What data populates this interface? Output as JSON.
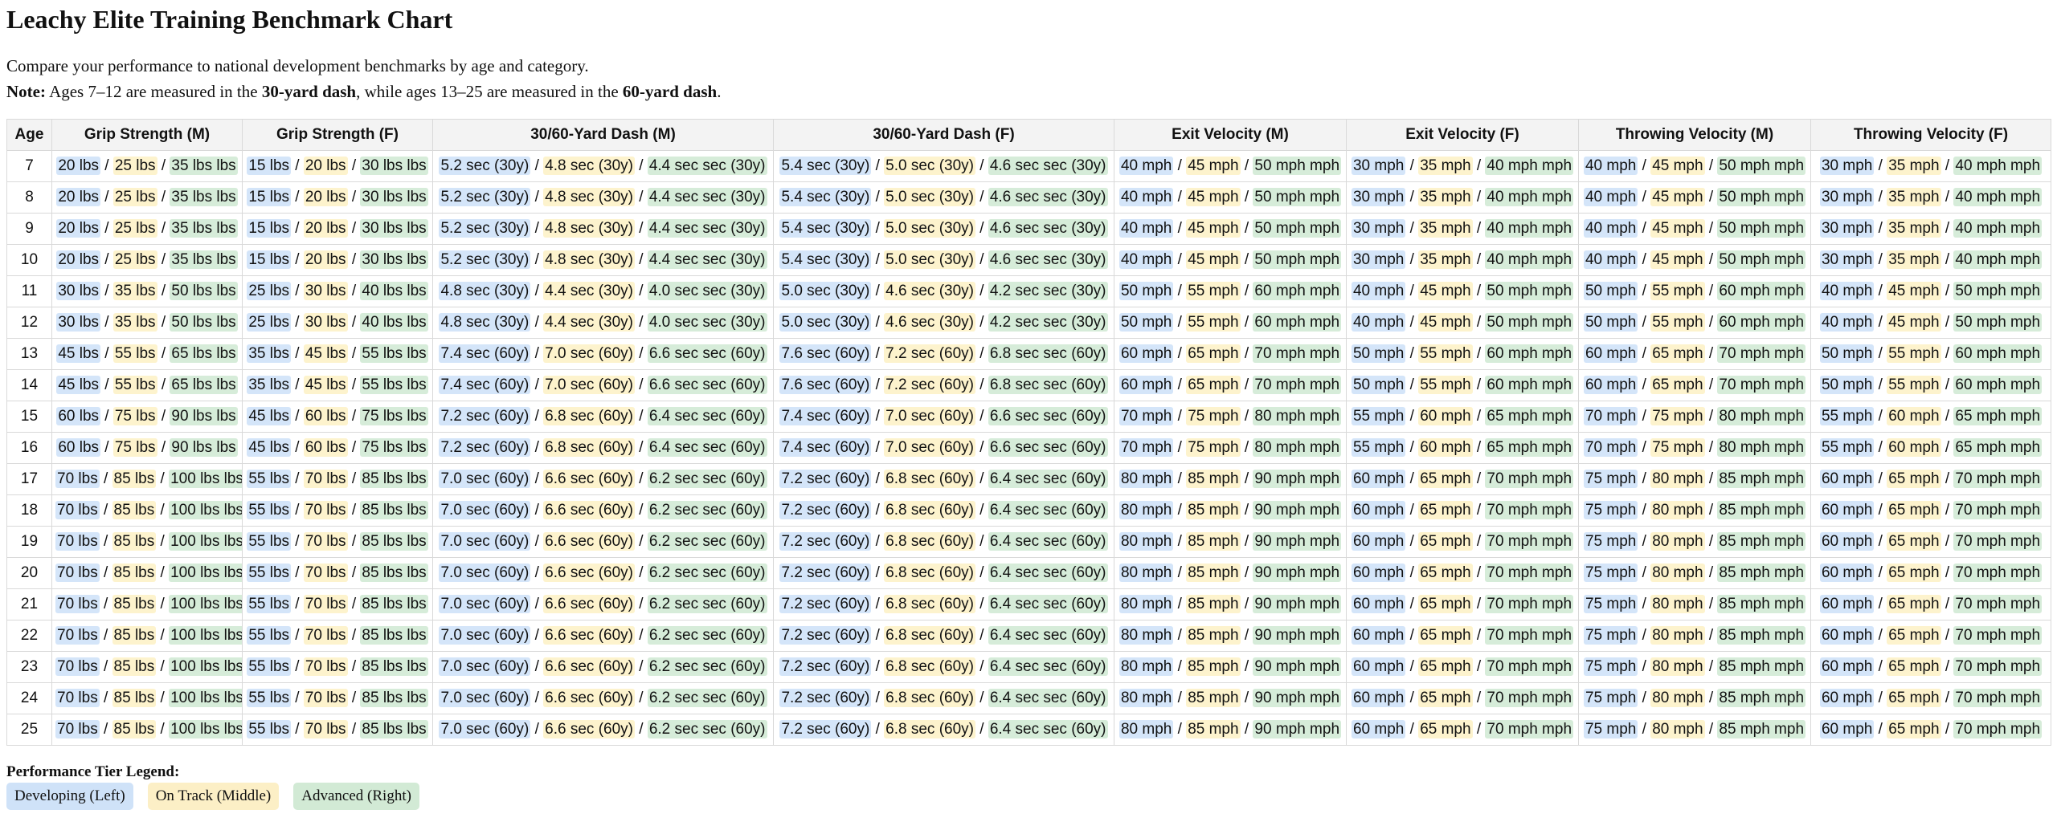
{
  "title": "Leachy Elite Training Benchmark Chart",
  "intro": "Compare your performance to national development benchmarks by age and category.",
  "note": {
    "label": "Note:",
    "text1": " Ages 7–12 are measured in the ",
    "bold1": "30-yard dash",
    "text2": ", while ages 13–25 are measured in the ",
    "bold2": "60-yard dash",
    "text3": "."
  },
  "columns": [
    "Age",
    "Grip Strength (M)",
    "Grip Strength (F)",
    "30/60-Yard Dash (M)",
    "30/60-Yard Dash (F)",
    "Exit Velocity (M)",
    "Exit Velocity (F)",
    "Throwing Velocity (M)",
    "Throwing Velocity (F)"
  ],
  "rows": [
    {
      "age": "7",
      "cells": [
        [
          "20 lbs",
          "25 lbs",
          "35 lbs lbs"
        ],
        [
          "15 lbs",
          "20 lbs",
          "30 lbs lbs"
        ],
        [
          "5.2 sec (30y)",
          "4.8 sec (30y)",
          "4.4 sec sec (30y)"
        ],
        [
          "5.4 sec (30y)",
          "5.0 sec (30y)",
          "4.6 sec sec (30y)"
        ],
        [
          "40 mph",
          "45 mph",
          "50 mph mph"
        ],
        [
          "30 mph",
          "35 mph",
          "40 mph mph"
        ],
        [
          "40 mph",
          "45 mph",
          "50 mph mph"
        ],
        [
          "30 mph",
          "35 mph",
          "40 mph mph"
        ]
      ]
    },
    {
      "age": "8",
      "cells": [
        [
          "20 lbs",
          "25 lbs",
          "35 lbs lbs"
        ],
        [
          "15 lbs",
          "20 lbs",
          "30 lbs lbs"
        ],
        [
          "5.2 sec (30y)",
          "4.8 sec (30y)",
          "4.4 sec sec (30y)"
        ],
        [
          "5.4 sec (30y)",
          "5.0 sec (30y)",
          "4.6 sec sec (30y)"
        ],
        [
          "40 mph",
          "45 mph",
          "50 mph mph"
        ],
        [
          "30 mph",
          "35 mph",
          "40 mph mph"
        ],
        [
          "40 mph",
          "45 mph",
          "50 mph mph"
        ],
        [
          "30 mph",
          "35 mph",
          "40 mph mph"
        ]
      ]
    },
    {
      "age": "9",
      "cells": [
        [
          "20 lbs",
          "25 lbs",
          "35 lbs lbs"
        ],
        [
          "15 lbs",
          "20 lbs",
          "30 lbs lbs"
        ],
        [
          "5.2 sec (30y)",
          "4.8 sec (30y)",
          "4.4 sec sec (30y)"
        ],
        [
          "5.4 sec (30y)",
          "5.0 sec (30y)",
          "4.6 sec sec (30y)"
        ],
        [
          "40 mph",
          "45 mph",
          "50 mph mph"
        ],
        [
          "30 mph",
          "35 mph",
          "40 mph mph"
        ],
        [
          "40 mph",
          "45 mph",
          "50 mph mph"
        ],
        [
          "30 mph",
          "35 mph",
          "40 mph mph"
        ]
      ]
    },
    {
      "age": "10",
      "cells": [
        [
          "20 lbs",
          "25 lbs",
          "35 lbs lbs"
        ],
        [
          "15 lbs",
          "20 lbs",
          "30 lbs lbs"
        ],
        [
          "5.2 sec (30y)",
          "4.8 sec (30y)",
          "4.4 sec sec (30y)"
        ],
        [
          "5.4 sec (30y)",
          "5.0 sec (30y)",
          "4.6 sec sec (30y)"
        ],
        [
          "40 mph",
          "45 mph",
          "50 mph mph"
        ],
        [
          "30 mph",
          "35 mph",
          "40 mph mph"
        ],
        [
          "40 mph",
          "45 mph",
          "50 mph mph"
        ],
        [
          "30 mph",
          "35 mph",
          "40 mph mph"
        ]
      ]
    },
    {
      "age": "11",
      "cells": [
        [
          "30 lbs",
          "35 lbs",
          "50 lbs lbs"
        ],
        [
          "25 lbs",
          "30 lbs",
          "40 lbs lbs"
        ],
        [
          "4.8 sec (30y)",
          "4.4 sec (30y)",
          "4.0 sec sec (30y)"
        ],
        [
          "5.0 sec (30y)",
          "4.6 sec (30y)",
          "4.2 sec sec (30y)"
        ],
        [
          "50 mph",
          "55 mph",
          "60 mph mph"
        ],
        [
          "40 mph",
          "45 mph",
          "50 mph mph"
        ],
        [
          "50 mph",
          "55 mph",
          "60 mph mph"
        ],
        [
          "40 mph",
          "45 mph",
          "50 mph mph"
        ]
      ]
    },
    {
      "age": "12",
      "cells": [
        [
          "30 lbs",
          "35 lbs",
          "50 lbs lbs"
        ],
        [
          "25 lbs",
          "30 lbs",
          "40 lbs lbs"
        ],
        [
          "4.8 sec (30y)",
          "4.4 sec (30y)",
          "4.0 sec sec (30y)"
        ],
        [
          "5.0 sec (30y)",
          "4.6 sec (30y)",
          "4.2 sec sec (30y)"
        ],
        [
          "50 mph",
          "55 mph",
          "60 mph mph"
        ],
        [
          "40 mph",
          "45 mph",
          "50 mph mph"
        ],
        [
          "50 mph",
          "55 mph",
          "60 mph mph"
        ],
        [
          "40 mph",
          "45 mph",
          "50 mph mph"
        ]
      ]
    },
    {
      "age": "13",
      "cells": [
        [
          "45 lbs",
          "55 lbs",
          "65 lbs lbs"
        ],
        [
          "35 lbs",
          "45 lbs",
          "55 lbs lbs"
        ],
        [
          "7.4 sec (60y)",
          "7.0 sec (60y)",
          "6.6 sec sec (60y)"
        ],
        [
          "7.6 sec (60y)",
          "7.2 sec (60y)",
          "6.8 sec sec (60y)"
        ],
        [
          "60 mph",
          "65 mph",
          "70 mph mph"
        ],
        [
          "50 mph",
          "55 mph",
          "60 mph mph"
        ],
        [
          "60 mph",
          "65 mph",
          "70 mph mph"
        ],
        [
          "50 mph",
          "55 mph",
          "60 mph mph"
        ]
      ]
    },
    {
      "age": "14",
      "cells": [
        [
          "45 lbs",
          "55 lbs",
          "65 lbs lbs"
        ],
        [
          "35 lbs",
          "45 lbs",
          "55 lbs lbs"
        ],
        [
          "7.4 sec (60y)",
          "7.0 sec (60y)",
          "6.6 sec sec (60y)"
        ],
        [
          "7.6 sec (60y)",
          "7.2 sec (60y)",
          "6.8 sec sec (60y)"
        ],
        [
          "60 mph",
          "65 mph",
          "70 mph mph"
        ],
        [
          "50 mph",
          "55 mph",
          "60 mph mph"
        ],
        [
          "60 mph",
          "65 mph",
          "70 mph mph"
        ],
        [
          "50 mph",
          "55 mph",
          "60 mph mph"
        ]
      ]
    },
    {
      "age": "15",
      "cells": [
        [
          "60 lbs",
          "75 lbs",
          "90 lbs lbs"
        ],
        [
          "45 lbs",
          "60 lbs",
          "75 lbs lbs"
        ],
        [
          "7.2 sec (60y)",
          "6.8 sec (60y)",
          "6.4 sec sec (60y)"
        ],
        [
          "7.4 sec (60y)",
          "7.0 sec (60y)",
          "6.6 sec sec (60y)"
        ],
        [
          "70 mph",
          "75 mph",
          "80 mph mph"
        ],
        [
          "55 mph",
          "60 mph",
          "65 mph mph"
        ],
        [
          "70 mph",
          "75 mph",
          "80 mph mph"
        ],
        [
          "55 mph",
          "60 mph",
          "65 mph mph"
        ]
      ]
    },
    {
      "age": "16",
      "cells": [
        [
          "60 lbs",
          "75 lbs",
          "90 lbs lbs"
        ],
        [
          "45 lbs",
          "60 lbs",
          "75 lbs lbs"
        ],
        [
          "7.2 sec (60y)",
          "6.8 sec (60y)",
          "6.4 sec sec (60y)"
        ],
        [
          "7.4 sec (60y)",
          "7.0 sec (60y)",
          "6.6 sec sec (60y)"
        ],
        [
          "70 mph",
          "75 mph",
          "80 mph mph"
        ],
        [
          "55 mph",
          "60 mph",
          "65 mph mph"
        ],
        [
          "70 mph",
          "75 mph",
          "80 mph mph"
        ],
        [
          "55 mph",
          "60 mph",
          "65 mph mph"
        ]
      ]
    },
    {
      "age": "17",
      "cells": [
        [
          "70 lbs",
          "85 lbs",
          "100 lbs lbs"
        ],
        [
          "55 lbs",
          "70 lbs",
          "85 lbs lbs"
        ],
        [
          "7.0 sec (60y)",
          "6.6 sec (60y)",
          "6.2 sec sec (60y)"
        ],
        [
          "7.2 sec (60y)",
          "6.8 sec (60y)",
          "6.4 sec sec (60y)"
        ],
        [
          "80 mph",
          "85 mph",
          "90 mph mph"
        ],
        [
          "60 mph",
          "65 mph",
          "70 mph mph"
        ],
        [
          "75 mph",
          "80 mph",
          "85 mph mph"
        ],
        [
          "60 mph",
          "65 mph",
          "70 mph mph"
        ]
      ]
    },
    {
      "age": "18",
      "cells": [
        [
          "70 lbs",
          "85 lbs",
          "100 lbs lbs"
        ],
        [
          "55 lbs",
          "70 lbs",
          "85 lbs lbs"
        ],
        [
          "7.0 sec (60y)",
          "6.6 sec (60y)",
          "6.2 sec sec (60y)"
        ],
        [
          "7.2 sec (60y)",
          "6.8 sec (60y)",
          "6.4 sec sec (60y)"
        ],
        [
          "80 mph",
          "85 mph",
          "90 mph mph"
        ],
        [
          "60 mph",
          "65 mph",
          "70 mph mph"
        ],
        [
          "75 mph",
          "80 mph",
          "85 mph mph"
        ],
        [
          "60 mph",
          "65 mph",
          "70 mph mph"
        ]
      ]
    },
    {
      "age": "19",
      "cells": [
        [
          "70 lbs",
          "85 lbs",
          "100 lbs lbs"
        ],
        [
          "55 lbs",
          "70 lbs",
          "85 lbs lbs"
        ],
        [
          "7.0 sec (60y)",
          "6.6 sec (60y)",
          "6.2 sec sec (60y)"
        ],
        [
          "7.2 sec (60y)",
          "6.8 sec (60y)",
          "6.4 sec sec (60y)"
        ],
        [
          "80 mph",
          "85 mph",
          "90 mph mph"
        ],
        [
          "60 mph",
          "65 mph",
          "70 mph mph"
        ],
        [
          "75 mph",
          "80 mph",
          "85 mph mph"
        ],
        [
          "60 mph",
          "65 mph",
          "70 mph mph"
        ]
      ]
    },
    {
      "age": "20",
      "cells": [
        [
          "70 lbs",
          "85 lbs",
          "100 lbs lbs"
        ],
        [
          "55 lbs",
          "70 lbs",
          "85 lbs lbs"
        ],
        [
          "7.0 sec (60y)",
          "6.6 sec (60y)",
          "6.2 sec sec (60y)"
        ],
        [
          "7.2 sec (60y)",
          "6.8 sec (60y)",
          "6.4 sec sec (60y)"
        ],
        [
          "80 mph",
          "85 mph",
          "90 mph mph"
        ],
        [
          "60 mph",
          "65 mph",
          "70 mph mph"
        ],
        [
          "75 mph",
          "80 mph",
          "85 mph mph"
        ],
        [
          "60 mph",
          "65 mph",
          "70 mph mph"
        ]
      ]
    },
    {
      "age": "21",
      "cells": [
        [
          "70 lbs",
          "85 lbs",
          "100 lbs lbs"
        ],
        [
          "55 lbs",
          "70 lbs",
          "85 lbs lbs"
        ],
        [
          "7.0 sec (60y)",
          "6.6 sec (60y)",
          "6.2 sec sec (60y)"
        ],
        [
          "7.2 sec (60y)",
          "6.8 sec (60y)",
          "6.4 sec sec (60y)"
        ],
        [
          "80 mph",
          "85 mph",
          "90 mph mph"
        ],
        [
          "60 mph",
          "65 mph",
          "70 mph mph"
        ],
        [
          "75 mph",
          "80 mph",
          "85 mph mph"
        ],
        [
          "60 mph",
          "65 mph",
          "70 mph mph"
        ]
      ]
    },
    {
      "age": "22",
      "cells": [
        [
          "70 lbs",
          "85 lbs",
          "100 lbs lbs"
        ],
        [
          "55 lbs",
          "70 lbs",
          "85 lbs lbs"
        ],
        [
          "7.0 sec (60y)",
          "6.6 sec (60y)",
          "6.2 sec sec (60y)"
        ],
        [
          "7.2 sec (60y)",
          "6.8 sec (60y)",
          "6.4 sec sec (60y)"
        ],
        [
          "80 mph",
          "85 mph",
          "90 mph mph"
        ],
        [
          "60 mph",
          "65 mph",
          "70 mph mph"
        ],
        [
          "75 mph",
          "80 mph",
          "85 mph mph"
        ],
        [
          "60 mph",
          "65 mph",
          "70 mph mph"
        ]
      ]
    },
    {
      "age": "23",
      "cells": [
        [
          "70 lbs",
          "85 lbs",
          "100 lbs lbs"
        ],
        [
          "55 lbs",
          "70 lbs",
          "85 lbs lbs"
        ],
        [
          "7.0 sec (60y)",
          "6.6 sec (60y)",
          "6.2 sec sec (60y)"
        ],
        [
          "7.2 sec (60y)",
          "6.8 sec (60y)",
          "6.4 sec sec (60y)"
        ],
        [
          "80 mph",
          "85 mph",
          "90 mph mph"
        ],
        [
          "60 mph",
          "65 mph",
          "70 mph mph"
        ],
        [
          "75 mph",
          "80 mph",
          "85 mph mph"
        ],
        [
          "60 mph",
          "65 mph",
          "70 mph mph"
        ]
      ]
    },
    {
      "age": "24",
      "cells": [
        [
          "70 lbs",
          "85 lbs",
          "100 lbs lbs"
        ],
        [
          "55 lbs",
          "70 lbs",
          "85 lbs lbs"
        ],
        [
          "7.0 sec (60y)",
          "6.6 sec (60y)",
          "6.2 sec sec (60y)"
        ],
        [
          "7.2 sec (60y)",
          "6.8 sec (60y)",
          "6.4 sec sec (60y)"
        ],
        [
          "80 mph",
          "85 mph",
          "90 mph mph"
        ],
        [
          "60 mph",
          "65 mph",
          "70 mph mph"
        ],
        [
          "75 mph",
          "80 mph",
          "85 mph mph"
        ],
        [
          "60 mph",
          "65 mph",
          "70 mph mph"
        ]
      ]
    },
    {
      "age": "25",
      "cells": [
        [
          "70 lbs",
          "85 lbs",
          "100 lbs lbs"
        ],
        [
          "55 lbs",
          "70 lbs",
          "85 lbs lbs"
        ],
        [
          "7.0 sec (60y)",
          "6.6 sec (60y)",
          "6.2 sec sec (60y)"
        ],
        [
          "7.2 sec (60y)",
          "6.8 sec (60y)",
          "6.4 sec sec (60y)"
        ],
        [
          "80 mph",
          "85 mph",
          "90 mph mph"
        ],
        [
          "60 mph",
          "65 mph",
          "70 mph mph"
        ],
        [
          "75 mph",
          "80 mph",
          "85 mph mph"
        ],
        [
          "60 mph",
          "65 mph",
          "70 mph mph"
        ]
      ]
    }
  ],
  "separator": " / ",
  "legend": {
    "title": "Performance Tier Legend:",
    "items": [
      "Developing (Left)",
      "On Track (Middle)",
      "Advanced (Right)"
    ]
  },
  "colors": {
    "developing": "#d4e5f9",
    "on_track": "#fdf3cd",
    "advanced": "#d6ecd9"
  }
}
